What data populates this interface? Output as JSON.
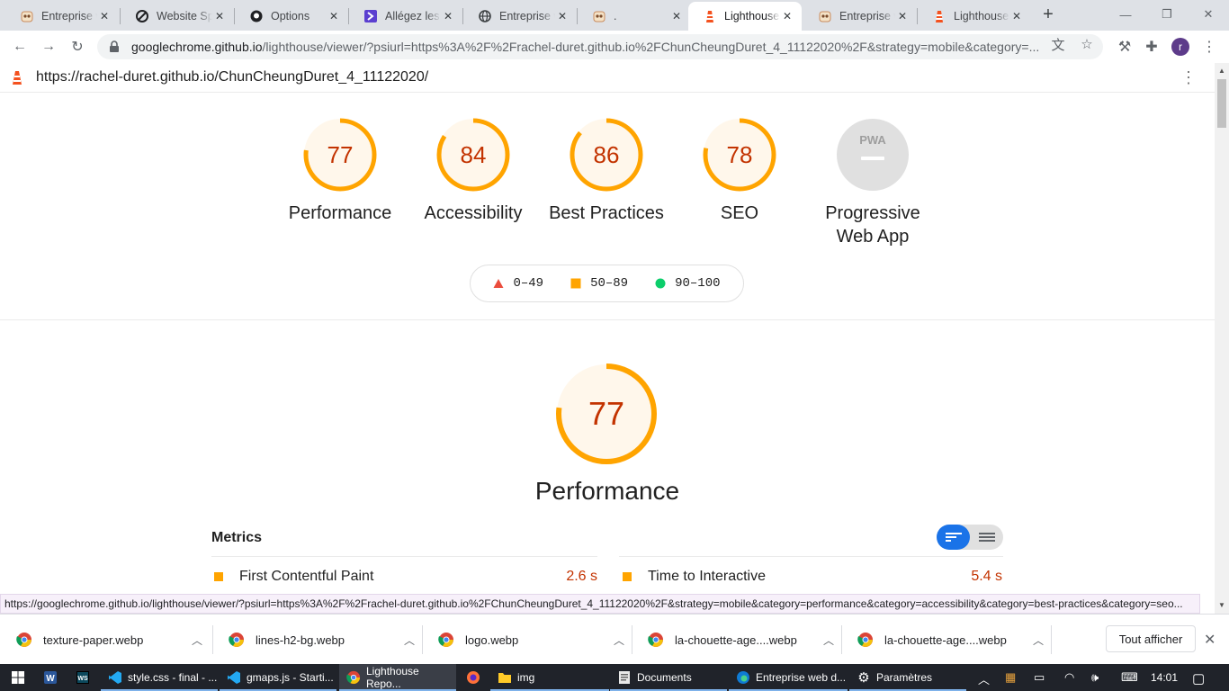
{
  "tabs": [
    {
      "title": "Entreprise w",
      "favicon": "owl-icon"
    },
    {
      "title": "Website Sp",
      "favicon": "blocked-icon"
    },
    {
      "title": "Options",
      "favicon": "github-icon"
    },
    {
      "title": "Allégez les",
      "favicon": "d-logo-icon"
    },
    {
      "title": "Entreprise w",
      "favicon": "globe-icon"
    },
    {
      "title": ".",
      "favicon": "owl-icon"
    },
    {
      "title": "Lighthouse",
      "favicon": "lighthouse-icon",
      "active": true
    },
    {
      "title": "Entreprise w",
      "favicon": "owl-icon"
    },
    {
      "title": "Lighthouse",
      "favicon": "lighthouse-icon"
    }
  ],
  "omnibox": {
    "host": "googlechrome.github.io",
    "path": "/lighthouse/viewer/?psiurl=https%3A%2F%2Frachel-duret.github.io%2FChunCheungDuret_4_11122020%2F&strategy=mobile&category=..."
  },
  "avatar_letter": "r",
  "report": {
    "url": "https://rachel-duret.github.io/ChunCheungDuret_4_11122020/",
    "gauges": [
      {
        "label": "Performance",
        "score": 77
      },
      {
        "label": "Accessibility",
        "score": 84
      },
      {
        "label": "Best Practices",
        "score": 86
      },
      {
        "label": "SEO",
        "score": 78
      }
    ],
    "pwa": {
      "label_line1": "Progressive",
      "label_line2": "Web App",
      "badge": "PWA"
    },
    "legend": [
      {
        "range": "0–49",
        "shape": "triangle",
        "color": "#eb4d3d"
      },
      {
        "range": "50–89",
        "shape": "square",
        "color": "#ffa400"
      },
      {
        "range": "90–100",
        "shape": "circle",
        "color": "#0cce6b"
      }
    ],
    "performance": {
      "score": 77,
      "title": "Performance"
    },
    "metrics_title": "Metrics",
    "metrics": [
      {
        "name": "First Contentful Paint",
        "value": "2.6 s"
      },
      {
        "name": "Time to Interactive",
        "value": "5.4 s"
      }
    ]
  },
  "status_url": "https://googlechrome.github.io/lighthouse/viewer/?psiurl=https%3A%2F%2Frachel-duret.github.io%2FChunCheungDuret_4_11122020%2F&strategy=mobile&category=performance&category=accessibility&category=best-practices&category=seo...",
  "downloads": [
    {
      "file": "texture-paper.webp"
    },
    {
      "file": "lines-h2-bg.webp"
    },
    {
      "file": "logo.webp"
    },
    {
      "file": "la-chouette-age....webp"
    },
    {
      "file": "la-chouette-age....webp"
    }
  ],
  "show_all_label": "Tout afficher",
  "taskbar": [
    {
      "label": "",
      "icon": "word-icon"
    },
    {
      "label": "",
      "icon": "webstorm-icon"
    },
    {
      "label": "style.css - final - ...",
      "icon": "vscode-icon"
    },
    {
      "label": "gmaps.js - Starti...",
      "icon": "vscode-icon"
    },
    {
      "label": "Lighthouse Repo...",
      "icon": "chrome-icon",
      "active": true
    },
    {
      "label": "",
      "icon": "firefox-icon"
    },
    {
      "label": "img",
      "icon": "folder-icon"
    },
    {
      "label": "Documents",
      "icon": "documents-icon"
    },
    {
      "label": "Entreprise web d...",
      "icon": "edge-icon"
    },
    {
      "label": "Paramètres",
      "icon": "settings-icon"
    }
  ],
  "clock": "14:01",
  "colors": {
    "average": "#ffa400",
    "average_text": "#c33300",
    "average_bg": "#fff7eb",
    "accent": "#1a73e8"
  }
}
